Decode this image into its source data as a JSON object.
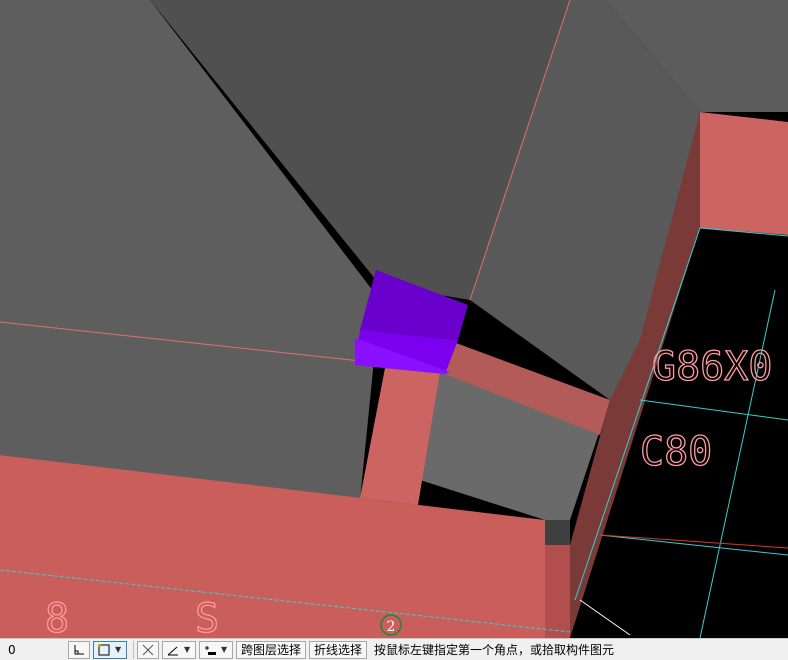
{
  "viewport": {
    "labels": {
      "dim_text": "G86X0",
      "code_text": "C80",
      "floor_code": "8",
      "floor_code_2": "S",
      "marker_number": "2"
    }
  },
  "statusbar": {
    "coordinate": "0",
    "cross_layer_select": "跨图层选择",
    "polyline_select": "折线选择",
    "prompt": "按鼠标左键指定第一个角点，或拾取构件图元"
  },
  "icons": {
    "ortho": "ortho-snap-icon",
    "select_box": "select-box-icon",
    "cross": "cross-icon",
    "angle": "angle-icon",
    "offset": "offset-icon"
  }
}
